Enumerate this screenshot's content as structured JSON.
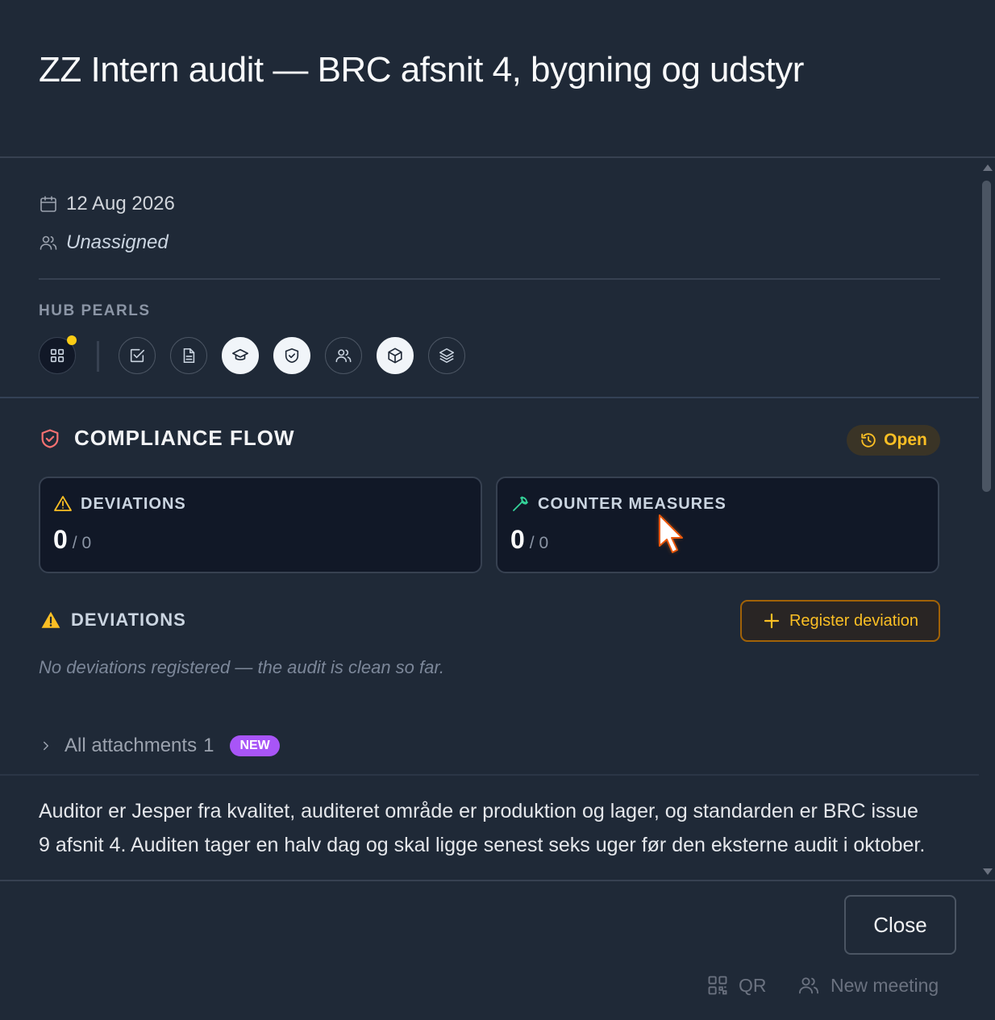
{
  "modal": {
    "title": "ZZ Intern audit — BRC afsnit 4, bygning og udstyr",
    "date": "12 Aug 2026",
    "assignee": "Unassigned"
  },
  "hub_pearls": {
    "label": "HUB PEARLS",
    "items": [
      {
        "icon": "grid-icon",
        "active": false,
        "has_dot": true
      },
      {
        "icon": "checkbox-icon",
        "active": false
      },
      {
        "icon": "document-icon",
        "active": false
      },
      {
        "icon": "graduation-cap-icon",
        "active": true
      },
      {
        "icon": "shield-check-icon",
        "active": true
      },
      {
        "icon": "users-icon",
        "active": false
      },
      {
        "icon": "cube-icon",
        "active": true
      },
      {
        "icon": "layers-icon",
        "active": false
      }
    ]
  },
  "compliance_flow": {
    "title": "COMPLIANCE FLOW",
    "status": "Open",
    "cards": [
      {
        "label": "DEVIATIONS",
        "value": "0",
        "total": "/ 0"
      },
      {
        "label": "COUNTER MEASURES",
        "value": "0",
        "total": "/ 0"
      }
    ]
  },
  "deviations": {
    "title": "DEVIATIONS",
    "register_label": "Register deviation",
    "empty_text": "No deviations registered — the audit is clean so far."
  },
  "attachments": {
    "label": "All attachments",
    "count": "1",
    "badge": "NEW"
  },
  "description": "Auditor er Jesper fra kvalitet, auditeret område er produktion og lager, og standarden er BRC issue 9 afsnit 4. Auditen tager en halv dag og skal ligge senest seks uger før den eksterne audit i oktober.",
  "footer": {
    "close_label": "Close",
    "qr_label": "QR",
    "new_meeting_label": "New meeting"
  },
  "colors": {
    "background": "#1f2937",
    "accent_amber": "#fbbf24",
    "accent_green": "#34d399",
    "accent_red": "#f87171",
    "badge_purple": "#a855f7"
  }
}
